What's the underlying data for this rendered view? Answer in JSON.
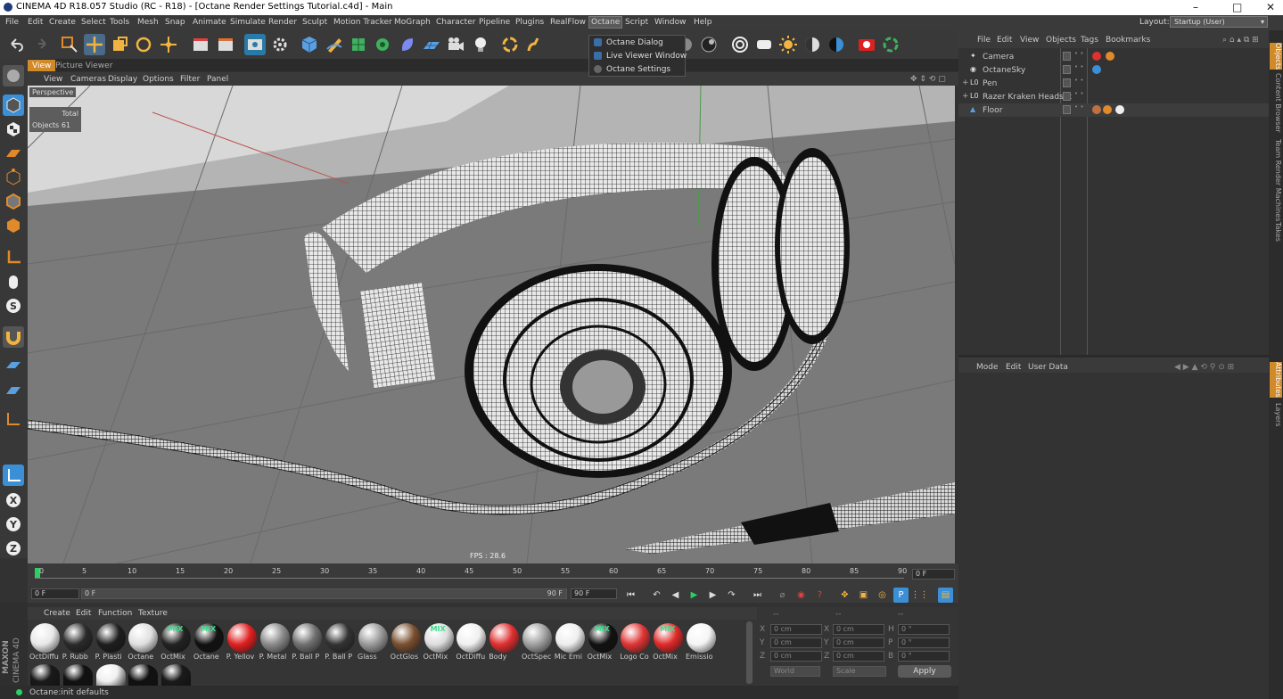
{
  "titlebar": {
    "title": "CINEMA 4D R18.057 Studio (RC - R18) - [Octane Render Settings Tutorial.c4d] - Main",
    "minimize": "–",
    "maximize": "□",
    "close": "✕"
  },
  "menubar": {
    "items": [
      "File",
      "Edit",
      "Create",
      "Select",
      "Tools",
      "Mesh",
      "Snap",
      "Animate",
      "Simulate",
      "Render",
      "Sculpt",
      "Motion Tracker",
      "MoGraph",
      "Character",
      "Pipeline",
      "Plugins",
      "RealFlow",
      "Octane",
      "Script",
      "Window",
      "Help"
    ],
    "active": "Octane",
    "layout_label": "Layout:",
    "layout_value": "Startup (User)"
  },
  "octane_menu": {
    "items": [
      "Octane Dialog",
      "Live Viewer Window",
      "Octane Settings"
    ]
  },
  "viewport": {
    "tabs": [
      "View",
      "Picture Viewer"
    ],
    "menu": [
      "View",
      "Cameras",
      "Display",
      "Options",
      "Filter",
      "Panel"
    ],
    "label": "Perspective",
    "stats_header": "Total",
    "stats_label": "Objects",
    "stats_value": "61",
    "fps": "FPS : 28.6"
  },
  "timeline": {
    "ticks": [
      "0",
      "5",
      "10",
      "15",
      "20",
      "25",
      "30",
      "35",
      "40",
      "45",
      "50",
      "55",
      "60",
      "65",
      "70",
      "75",
      "80",
      "85",
      "90"
    ],
    "end_field": "0 F",
    "current_frame": "0 F",
    "range_start": "0 F",
    "range_end": "90 F",
    "max_frame": "90 F"
  },
  "materials": {
    "menu": [
      "Create",
      "Edit",
      "Function",
      "Texture"
    ],
    "items": [
      {
        "name": "OctDiffu",
        "color": "#e8e8e8",
        "mix": ""
      },
      {
        "name": "P. Rubb",
        "color": "#2a2a2a",
        "mix": ""
      },
      {
        "name": "P. Plasti",
        "color": "#1e1e1e",
        "mix": ""
      },
      {
        "name": "Octane",
        "color": "#e0e0e0",
        "mix": ""
      },
      {
        "name": "OctMix",
        "color": "#222",
        "mix": "MIX"
      },
      {
        "name": "Octane",
        "color": "#111",
        "mix": "MIX"
      },
      {
        "name": "P. Yellov",
        "color": "#e02020",
        "mix": ""
      },
      {
        "name": "P. Metal",
        "color": "#8a8a8a",
        "mix": ""
      },
      {
        "name": "P. Ball P",
        "color": "#707070",
        "mix": ""
      },
      {
        "name": "P. Ball P",
        "color": "#333",
        "mix": ""
      },
      {
        "name": "Glass",
        "color": "#9a9a9a",
        "mix": ""
      },
      {
        "name": "OctGlos",
        "color": "#7a5030",
        "mix": ""
      },
      {
        "name": "OctMix",
        "color": "#ddd",
        "mix": "MIX"
      },
      {
        "name": "OctDiffu",
        "color": "#f0f0f0",
        "mix": ""
      },
      {
        "name": "Body",
        "color": "#e03030",
        "mix": ""
      },
      {
        "name": "OctSpec",
        "color": "#a0a0a0",
        "mix": ""
      },
      {
        "name": "Mic Emi",
        "color": "#eee",
        "mix": ""
      },
      {
        "name": "OctMix",
        "color": "#111",
        "mix": "MIX"
      },
      {
        "name": "Logo Co",
        "color": "#e03535",
        "mix": ""
      },
      {
        "name": "OctMix",
        "color": "#e02a2a",
        "mix": "MIX"
      },
      {
        "name": "Emissio",
        "color": "#f5f5f5",
        "mix": ""
      }
    ],
    "row2_colors": [
      "#1a1a1a",
      "#111",
      "#f0f0f0",
      "#111",
      "#1a1a1a"
    ]
  },
  "coords": {
    "headers": [
      "--",
      "--",
      "--"
    ],
    "rows": [
      {
        "a": "X",
        "av": "0 cm",
        "b": "X",
        "bv": "0 cm",
        "c": "H",
        "cv": "0 °"
      },
      {
        "a": "Y",
        "av": "0 cm",
        "b": "Y",
        "bv": "0 cm",
        "c": "P",
        "cv": "0 °"
      },
      {
        "a": "Z",
        "av": "0 cm",
        "b": "Z",
        "bv": "0 cm",
        "c": "B",
        "cv": "0 °"
      }
    ],
    "mode": "World",
    "scale": "Scale",
    "apply": "Apply"
  },
  "status": "Octane:init defaults",
  "brand": {
    "maxon": "MAXON",
    "cinema": "CINEMA 4D"
  },
  "object_manager": {
    "menu": [
      "File",
      "Edit",
      "View",
      "Objects",
      "Tags",
      "Bookmarks"
    ],
    "objects": [
      {
        "name": "Camera",
        "expand": ""
      },
      {
        "name": "OctaneSky",
        "expand": ""
      },
      {
        "name": "Pen",
        "expand": "+"
      },
      {
        "name": "Razer Kraken Headset",
        "expand": "+"
      },
      {
        "name": "Floor",
        "expand": ""
      }
    ]
  },
  "attribute_manager": {
    "menu": [
      "Mode",
      "Edit",
      "User Data"
    ]
  },
  "right_tabs": [
    "Objects",
    "Content Browser",
    "Team Render Machines",
    "Takes",
    "Attributes",
    "Layers"
  ],
  "colors": {
    "accent": "#3b8fd6",
    "active_tab": "#d08a2a"
  }
}
